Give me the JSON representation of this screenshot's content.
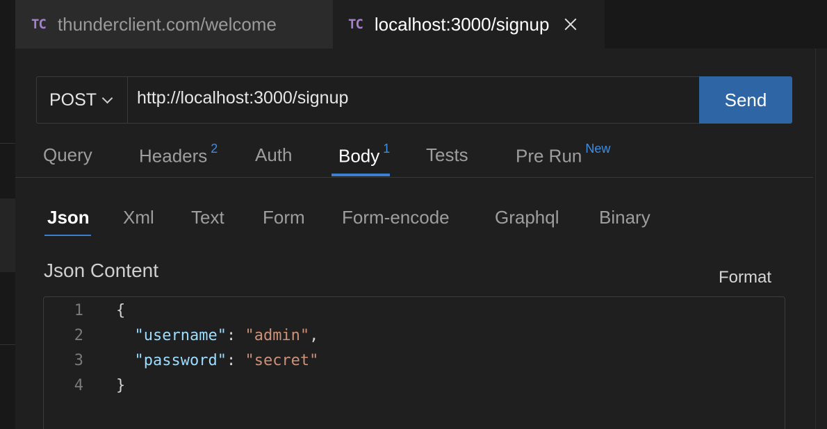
{
  "tabs": [
    {
      "icon": "TC",
      "label": "thunderclient.com/welcome",
      "active": false
    },
    {
      "icon": "TC",
      "label": "localhost:3000/signup",
      "active": true
    }
  ],
  "request": {
    "method": "POST",
    "url": "http://localhost:3000/signup",
    "send_label": "Send"
  },
  "main_tabs": [
    {
      "label": "Query",
      "badge": ""
    },
    {
      "label": "Headers",
      "badge": "2"
    },
    {
      "label": "Auth",
      "badge": ""
    },
    {
      "label": "Body",
      "badge": "1"
    },
    {
      "label": "Tests",
      "badge": ""
    },
    {
      "label": "Pre Run",
      "badge": "New"
    }
  ],
  "body_tabs": [
    "Json",
    "Xml",
    "Text",
    "Form",
    "Form-encode",
    "Graphql",
    "Binary"
  ],
  "json_content": {
    "title": "Json Content",
    "format_label": "Format",
    "line_numbers": [
      "1",
      "2",
      "3",
      "4"
    ],
    "open_brace": "{",
    "close_brace": "}",
    "username_key": "\"username\"",
    "username_value": "\"admin\"",
    "password_key": "\"password\"",
    "password_value": "\"secret\""
  },
  "colors": {
    "accent": "#2d65a5",
    "badge": "#3d8ee6",
    "tc_icon": "#a67fce",
    "json_key": "#9cdcfe",
    "json_string": "#ce9178"
  }
}
